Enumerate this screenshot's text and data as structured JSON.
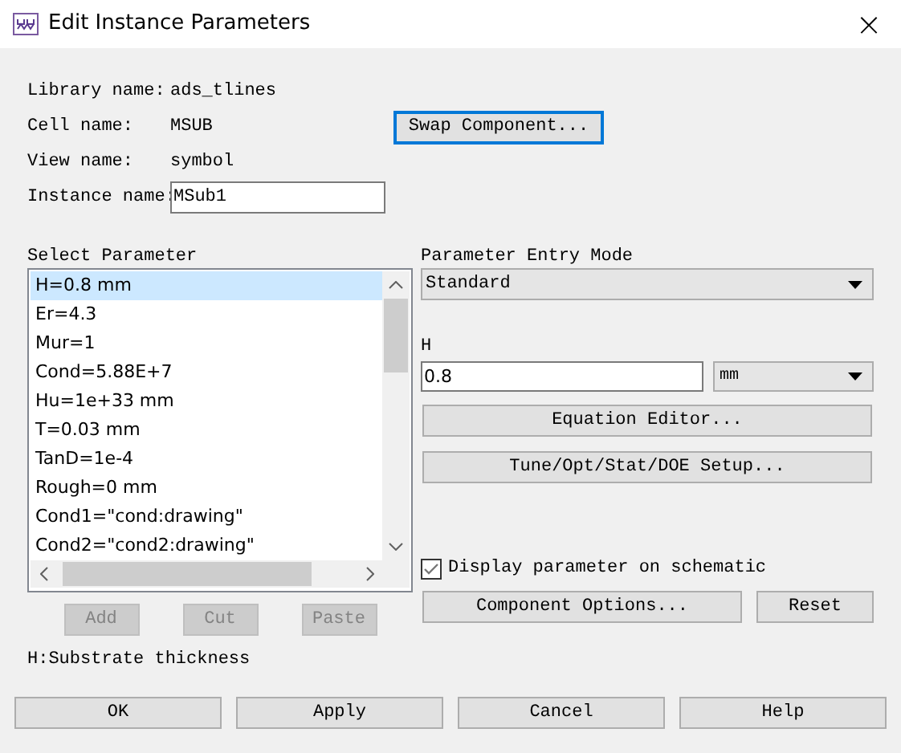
{
  "window": {
    "title": "Edit Instance Parameters",
    "close": "×"
  },
  "info": [
    {
      "label": "Library name:",
      "value": "ads_tlines"
    },
    {
      "label": "Cell name:",
      "value": "MSUB"
    },
    {
      "label": "View name:",
      "value": "symbol"
    }
  ],
  "swap_button": "Swap Component...",
  "instance": {
    "label": "Instance name:",
    "value": "MSub1"
  },
  "select_parameter": {
    "label": "Select Parameter",
    "items": [
      {
        "text": "H=0.8 mm",
        "selected": true
      },
      {
        "text": "Er=4.3",
        "selected": false
      },
      {
        "text": "Mur=1",
        "selected": false
      },
      {
        "text": "Cond=5.88E+7",
        "selected": false
      },
      {
        "text": "Hu=1e+33 mm",
        "selected": false
      },
      {
        "text": "T=0.03 mm",
        "selected": false
      },
      {
        "text": "TanD=1e-4",
        "selected": false
      },
      {
        "text": "Rough=0 mm",
        "selected": false
      },
      {
        "text": "Cond1=\"cond:drawing\"",
        "selected": false
      },
      {
        "text": "Cond2=\"cond2:drawing\"",
        "selected": false
      }
    ],
    "buttons": [
      {
        "label": "Add",
        "disabled": true
      },
      {
        "label": "Cut",
        "disabled": true
      },
      {
        "label": "Paste",
        "disabled": true
      }
    ]
  },
  "entry_mode": {
    "label": "Parameter Entry Mode",
    "value": "Standard"
  },
  "parameter": {
    "label": "H",
    "value": "0.8",
    "unit": "mm"
  },
  "equation_editor": "Equation Editor...",
  "tune_setup": "Tune/Opt/Stat/DOE Setup...",
  "display_on_schematic": {
    "label": "Display parameter on schematic",
    "checked": true
  },
  "component_options": "Component Options...",
  "reset": "Reset",
  "description": "H:Substrate thickness",
  "footer_buttons": [
    "OK",
    "Apply",
    "Cancel",
    "Help"
  ]
}
